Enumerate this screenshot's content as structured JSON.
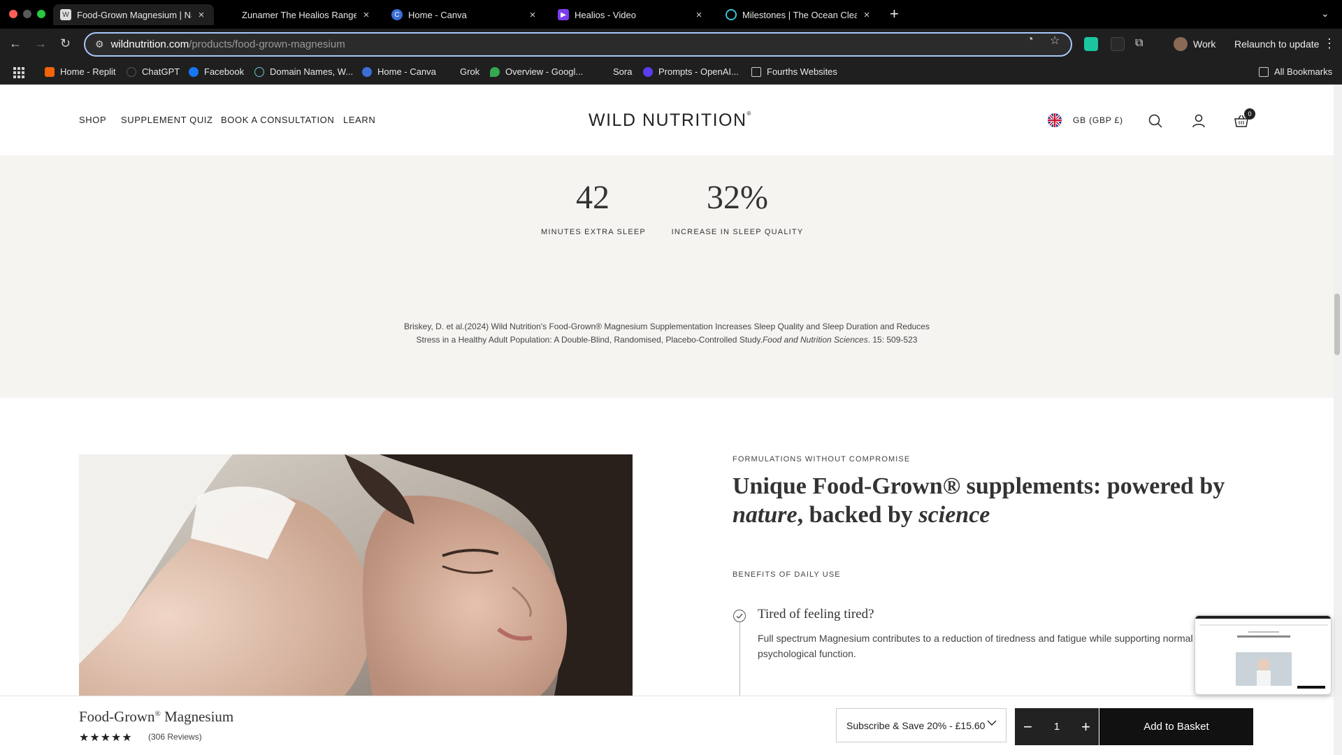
{
  "browser": {
    "tabs": [
      {
        "title": "Food-Grown Magnesium | Nat",
        "active": true
      },
      {
        "title": "Zunamer The Healios Range",
        "active": false
      },
      {
        "title": "Home - Canva",
        "active": false
      },
      {
        "title": "Healios - Video",
        "active": false
      },
      {
        "title": "Milestones | The Ocean Clean",
        "active": false
      }
    ],
    "url_host": "wildnutrition.com",
    "url_path": "/products/food-grown-magnesium",
    "profile_label": "Work",
    "relaunch_label": "Relaunch to update",
    "bookmarks": [
      "Home - Replit",
      "ChatGPT",
      "Facebook",
      "Domain Names, W...",
      "Home - Canva",
      "Grok",
      "Overview - Googl...",
      "Sora",
      "Prompts - OpenAI...",
      "Fourths Websites"
    ],
    "all_bookmarks_label": "All Bookmarks"
  },
  "site": {
    "nav": [
      "SHOP",
      "SUPPLEMENT QUIZ",
      "BOOK A CONSULTATION",
      "LEARN"
    ],
    "logo": "WILD NUTRITION",
    "logo_mark": "®",
    "locale": "GB (GBP £)",
    "cart_count": "0"
  },
  "stats": {
    "items": [
      {
        "value": "42",
        "label": "MINUTES EXTRA SLEEP"
      },
      {
        "value": "32%",
        "label": "INCREASE IN SLEEP QUALITY"
      }
    ],
    "citation_main": "Briskey, D. et al.(2024) Wild Nutrition's Food-Grown® Magnesium Supplementation Increases Sleep Quality and Sleep Duration and Reduces Stress in a Healthy Adult Population: A Double-Blind, Randomised, Placebo-Controlled Study.",
    "citation_journal": "Food and Nutrition Sciences",
    "citation_tail": ". 15: 509-523"
  },
  "formulations": {
    "eyebrow": "FORMULATIONS WITHOUT COMPROMISE",
    "headline_part1": "Unique Food-Grown® supplements: powered by ",
    "headline_em1": "nature",
    "headline_part2": ", backed by ",
    "headline_em2": "science",
    "benefits_eyebrow": "BENEFITS OF DAILY USE",
    "benefit_title": "Tired of feeling tired?",
    "benefit_text": "Full spectrum Magnesium contributes to a reduction of tiredness and fatigue while supporting normal psychological function."
  },
  "sticky": {
    "product_name": "Food-Grown",
    "product_mark": "®",
    "product_name_tail": " Magnesium",
    "stars": "★★★★★",
    "rating": 4.5,
    "reviews": "(306 Reviews)",
    "subscription": "Subscribe & Save 20% - £15.60",
    "quantity": "1",
    "add_label": "Add to Basket"
  },
  "colors": {
    "accent": "#a8c7fa",
    "section_bg": "#f5f4f1",
    "button_dark": "#111111"
  }
}
